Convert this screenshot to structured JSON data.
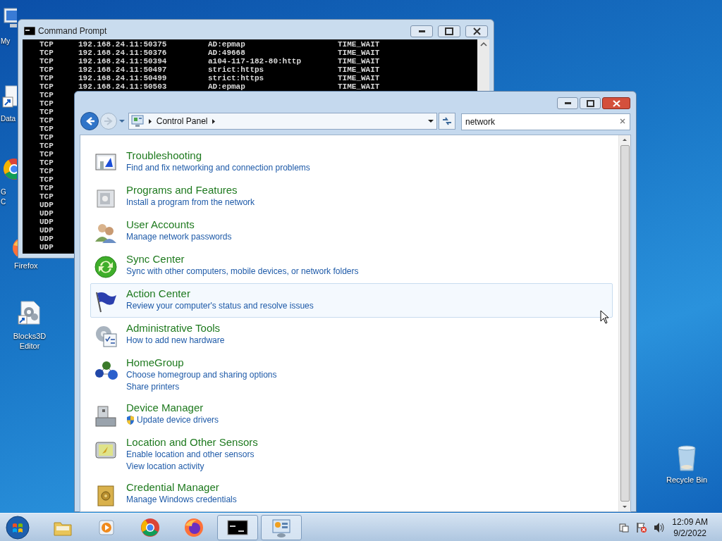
{
  "desktop_icons": [
    {
      "kind": "computer",
      "label_lines": [
        "My"
      ]
    },
    {
      "kind": "shortcut",
      "label_lines": [
        "Data"
      ]
    },
    {
      "kind": "chrome",
      "label_lines": [
        "G",
        "C"
      ]
    },
    {
      "kind": "firefox",
      "label_lines": [
        "Firefox"
      ]
    },
    {
      "kind": "gears",
      "label_lines": [
        "Blocks3D",
        "Editor"
      ]
    },
    {
      "kind": "recycle",
      "label_lines": [
        "Recycle Bin"
      ]
    }
  ],
  "command_prompt": {
    "title": "Command Prompt",
    "rows": [
      {
        "proto": "TCP",
        "local": "192.168.24.11:50375",
        "foreign": "AD:epmap",
        "state": "TIME_WAIT"
      },
      {
        "proto": "TCP",
        "local": "192.168.24.11:50376",
        "foreign": "AD:49668",
        "state": "TIME_WAIT"
      },
      {
        "proto": "TCP",
        "local": "192.168.24.11:50394",
        "foreign": "a104-117-182-80:http",
        "state": "TIME_WAIT"
      },
      {
        "proto": "TCP",
        "local": "192.168.24.11:50497",
        "foreign": "strict:https",
        "state": "TIME_WAIT"
      },
      {
        "proto": "TCP",
        "local": "192.168.24.11:50499",
        "foreign": "strict:https",
        "state": "TIME_WAIT"
      },
      {
        "proto": "TCP",
        "local": "192.168.24.11:50503",
        "foreign": "AD:epmap",
        "state": "TIME_WAIT"
      },
      {
        "proto": "TCP"
      },
      {
        "proto": "TCP"
      },
      {
        "proto": "TCP"
      },
      {
        "proto": "TCP"
      },
      {
        "proto": "TCP"
      },
      {
        "proto": "TCP"
      },
      {
        "proto": "TCP"
      },
      {
        "proto": "TCP"
      },
      {
        "proto": "TCP"
      },
      {
        "proto": "TCP"
      },
      {
        "proto": "TCP"
      },
      {
        "proto": "TCP"
      },
      {
        "proto": "TCP"
      },
      {
        "proto": "UDP"
      },
      {
        "proto": "UDP"
      },
      {
        "proto": "UDP"
      },
      {
        "proto": "UDP"
      },
      {
        "proto": "UDP"
      },
      {
        "proto": "UDP"
      }
    ]
  },
  "control_panel": {
    "breadcrumb": "Control Panel",
    "search": {
      "value": "network"
    },
    "items": [
      {
        "kind": "troubleshooting",
        "title": "Troubleshooting",
        "highlighted": false,
        "links": [
          {
            "text": "Find and fix networking and connection problems",
            "shield": false
          }
        ]
      },
      {
        "kind": "programs",
        "title": "Programs and Features",
        "highlighted": false,
        "links": [
          {
            "text": "Install a program from the network",
            "shield": false
          }
        ]
      },
      {
        "kind": "users",
        "title": "User Accounts",
        "highlighted": false,
        "links": [
          {
            "text": "Manage network passwords",
            "shield": false
          }
        ]
      },
      {
        "kind": "sync",
        "title": "Sync Center",
        "highlighted": false,
        "links": [
          {
            "text": "Sync with other computers, mobile devices, or network folders",
            "shield": false
          }
        ]
      },
      {
        "kind": "flag",
        "title": "Action Center",
        "highlighted": true,
        "links": [
          {
            "text": "Review your computer's status and resolve issues",
            "shield": false
          }
        ]
      },
      {
        "kind": "admin",
        "title": "Administrative Tools",
        "highlighted": false,
        "links": [
          {
            "text": "How to add new hardware",
            "shield": false
          }
        ]
      },
      {
        "kind": "homegroup",
        "title": "HomeGroup",
        "highlighted": false,
        "links": [
          {
            "text": "Choose homegroup and sharing options",
            "shield": false
          },
          {
            "text": "Share printers",
            "shield": false
          }
        ]
      },
      {
        "kind": "device",
        "title": "Device Manager",
        "highlighted": false,
        "links": [
          {
            "text": "Update device drivers",
            "shield": true
          }
        ]
      },
      {
        "kind": "location",
        "title": "Location and Other Sensors",
        "highlighted": false,
        "links": [
          {
            "text": "Enable location and other sensors",
            "shield": false
          },
          {
            "text": "View location activity",
            "shield": false
          }
        ]
      },
      {
        "kind": "credential",
        "title": "Credential Manager",
        "highlighted": false,
        "links": [
          {
            "text": "Manage Windows credentials",
            "shield": false
          }
        ]
      }
    ]
  },
  "taskbar": {
    "items": [
      {
        "kind": "explorer",
        "active": false
      },
      {
        "kind": "media",
        "active": false
      },
      {
        "kind": "chrome",
        "active": false
      },
      {
        "kind": "firefox",
        "active": false
      },
      {
        "kind": "cmd",
        "active": true
      },
      {
        "kind": "controlpanel",
        "active": true
      }
    ],
    "clock": {
      "time": "12:09 AM",
      "date": "9/2/2022"
    }
  }
}
